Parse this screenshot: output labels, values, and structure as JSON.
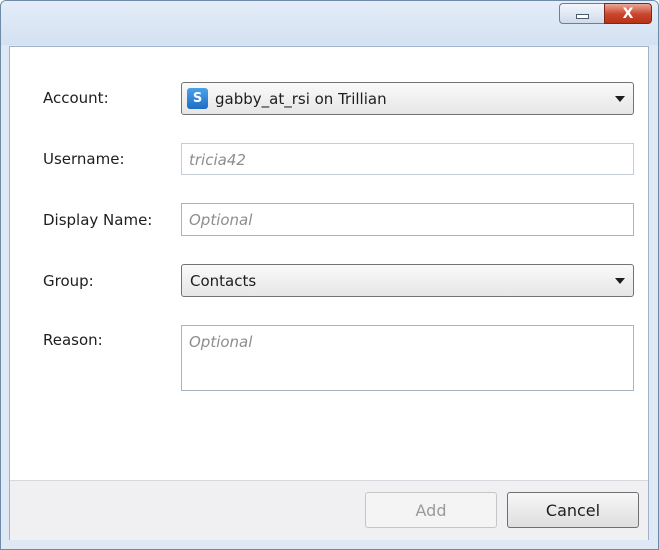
{
  "window": {
    "controls": {
      "close_glyph": "X"
    }
  },
  "form": {
    "account": {
      "label": "Account:",
      "value": "gabby_at_rsi on Trillian",
      "icon": "trillian-icon"
    },
    "username": {
      "label": "Username:",
      "placeholder": "tricia42"
    },
    "display_name": {
      "label": "Display Name:",
      "placeholder": "Optional"
    },
    "group": {
      "label": "Group:",
      "value": "Contacts"
    },
    "reason": {
      "label": "Reason:",
      "placeholder": "Optional"
    }
  },
  "buttons": {
    "add": "Add",
    "cancel": "Cancel"
  },
  "colors": {
    "accent": "#1f6dc6",
    "close": "#c8442a"
  }
}
